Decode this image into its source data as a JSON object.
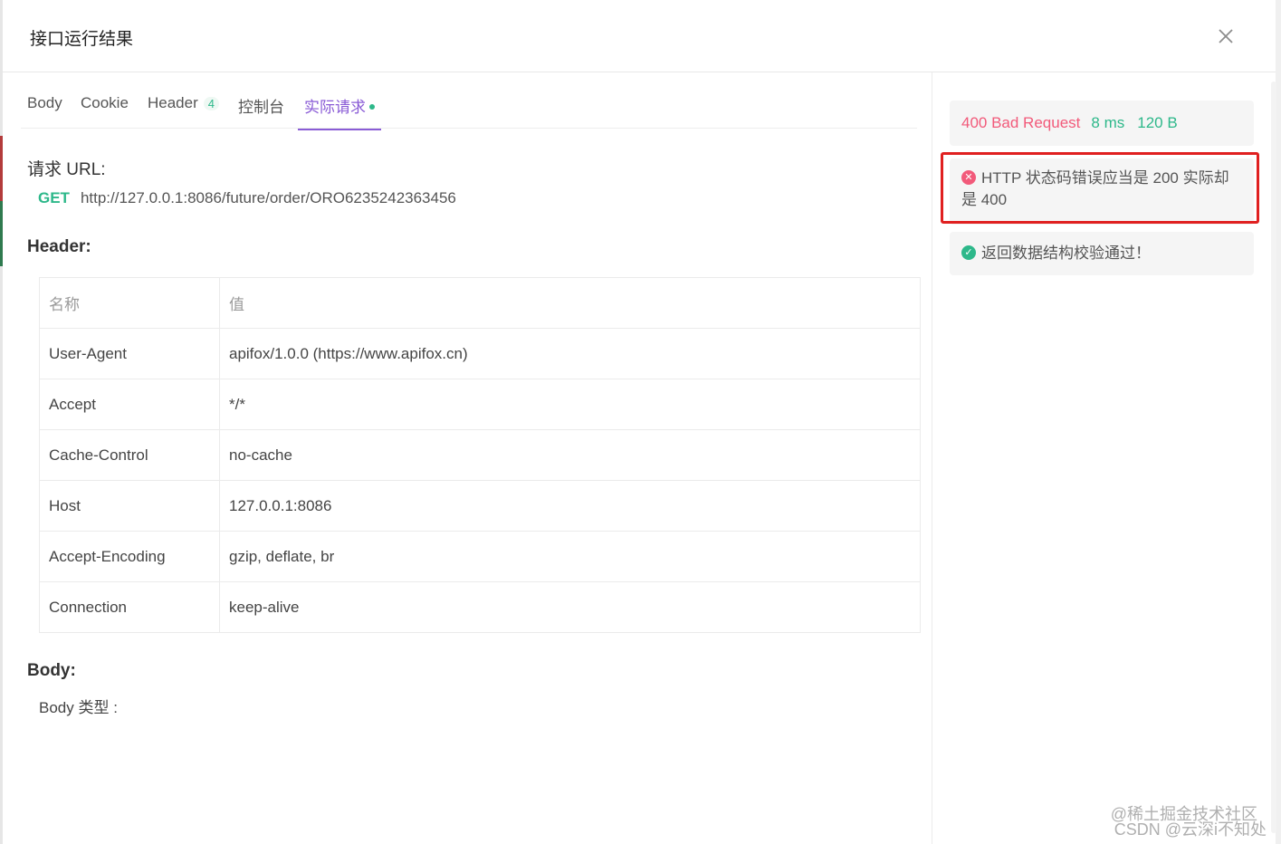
{
  "modal": {
    "title": "接口运行结果"
  },
  "tabs": [
    {
      "label": "Body"
    },
    {
      "label": "Cookie"
    },
    {
      "label": "Header",
      "count": "4"
    },
    {
      "label": "控制台"
    },
    {
      "label": "实际请求"
    }
  ],
  "request": {
    "url_label": "请求 URL:",
    "method": "GET",
    "url": "http://127.0.0.1:8086/future/order/ORO6235242363456"
  },
  "headers": {
    "label": "Header:",
    "columns": [
      "名称",
      "值"
    ],
    "rows": [
      {
        "name": "User-Agent",
        "value": "apifox/1.0.0 (https://www.apifox.cn)"
      },
      {
        "name": "Accept",
        "value": "*/*"
      },
      {
        "name": "Cache-Control",
        "value": "no-cache"
      },
      {
        "name": "Host",
        "value": "127.0.0.1:8086"
      },
      {
        "name": "Accept-Encoding",
        "value": "gzip, deflate, br"
      },
      {
        "name": "Connection",
        "value": "keep-alive"
      }
    ]
  },
  "body": {
    "label": "Body:",
    "type_label": "Body 类型 :"
  },
  "response": {
    "status": "400 Bad Request",
    "time": "8 ms",
    "size": "120 B"
  },
  "assertions": [
    {
      "result": "fail",
      "icon": "x-circle-icon",
      "text": "HTTP 状态码错误应当是 200 实际却是 400"
    },
    {
      "result": "pass",
      "icon": "check-circle-icon",
      "text": "返回数据结构校验通过！"
    }
  ],
  "watermark": {
    "line1": "@稀土掘金技术社区",
    "line2": "CSDN @云深i不知处"
  },
  "colors": {
    "accent": "#8a5cd6",
    "success": "#2db88a",
    "error": "#f25a7a",
    "highlight": "#e02020"
  }
}
